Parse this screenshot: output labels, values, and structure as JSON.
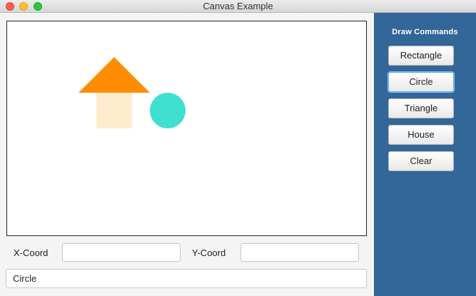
{
  "window": {
    "title": "Canvas Example"
  },
  "canvas": {
    "shapes": [
      {
        "kind": "roof-triangle",
        "color": "#ff8c00"
      },
      {
        "kind": "house-body-rectangle",
        "color": "#ffebcd"
      },
      {
        "kind": "circle",
        "color": "#40e0d0"
      }
    ]
  },
  "coords": {
    "x_label": "X-Coord",
    "x_value": "",
    "y_label": "Y-Coord",
    "y_value": ""
  },
  "status": {
    "text": "Circle"
  },
  "sidebar": {
    "title": "Draw Commands",
    "buttons": [
      {
        "label": "Rectangle"
      },
      {
        "label": "Circle"
      },
      {
        "label": "Triangle"
      },
      {
        "label": "House"
      },
      {
        "label": "Clear"
      }
    ],
    "focused_button": "Circle",
    "background": "#336699"
  }
}
